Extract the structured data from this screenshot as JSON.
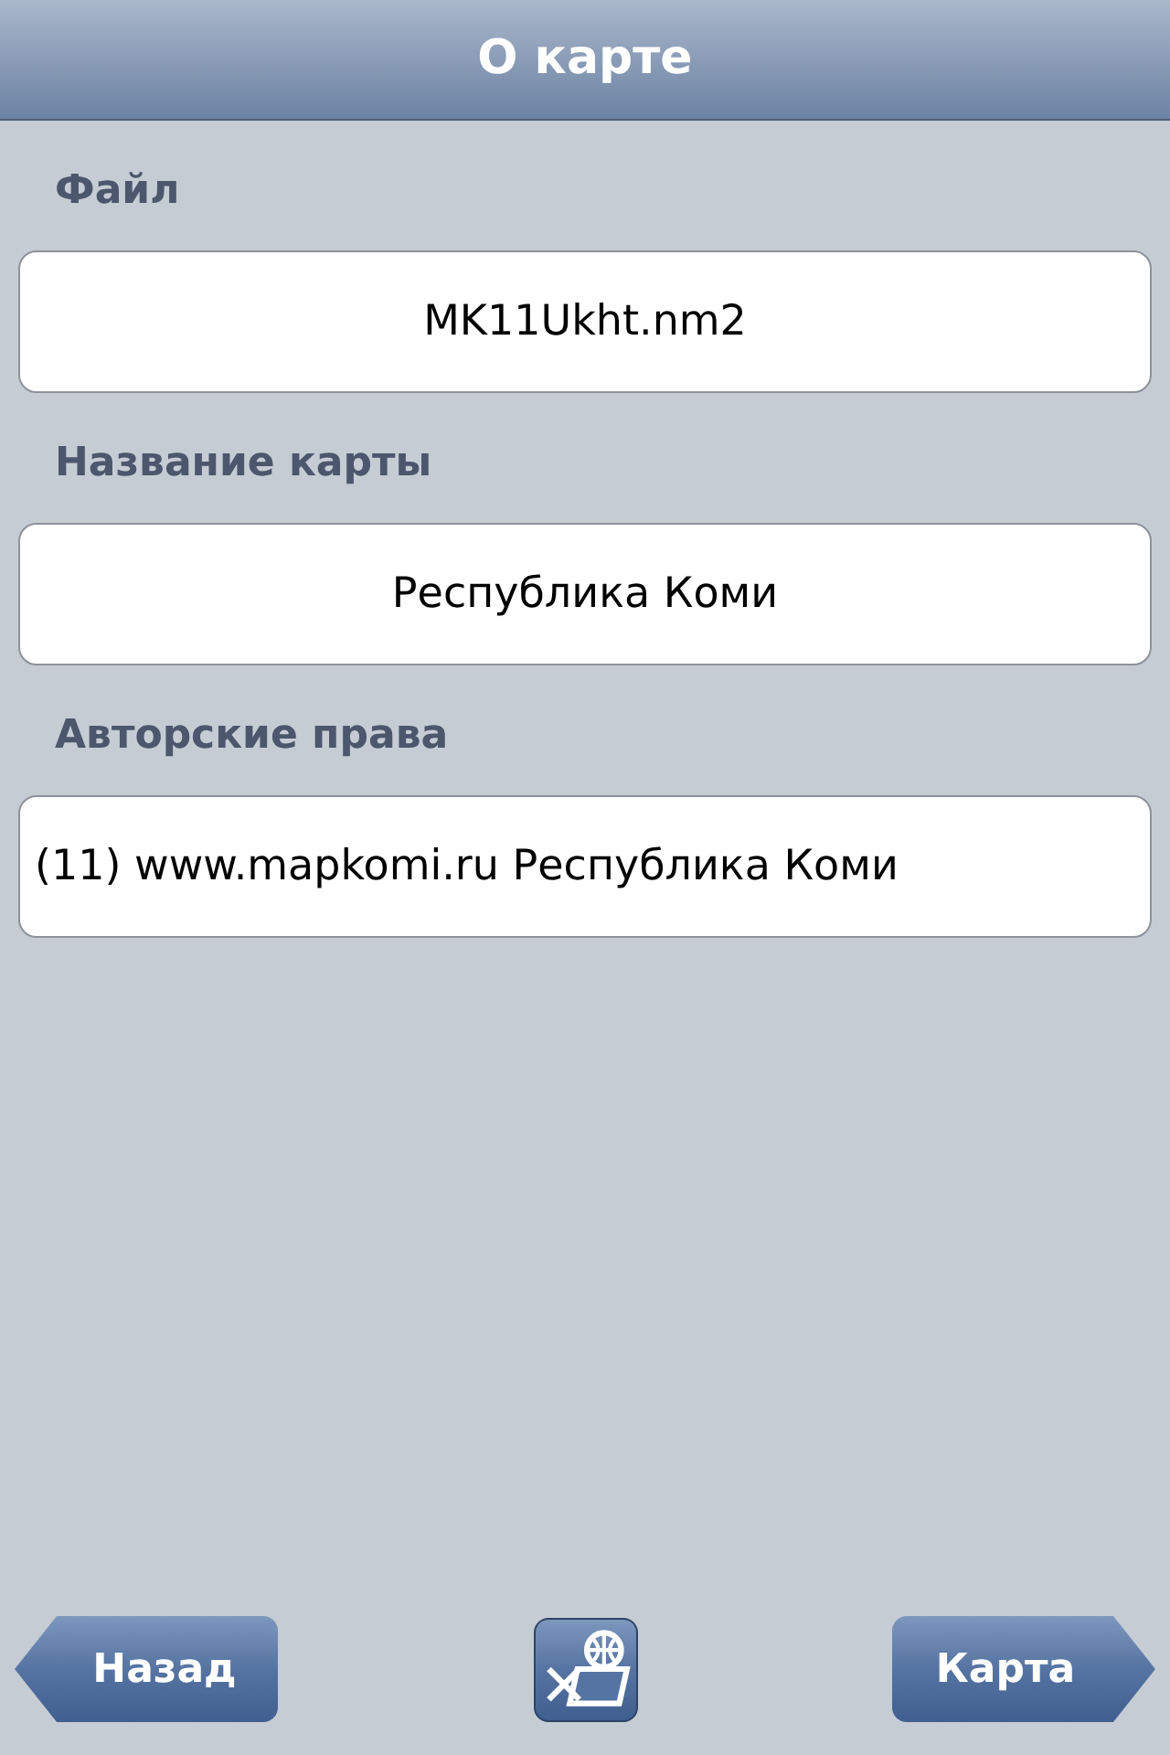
{
  "header": {
    "title": "О карте"
  },
  "fields": [
    {
      "label": "Файл",
      "value": "MK11Ukht.nm2",
      "kind": "centered"
    },
    {
      "label": "Название карты",
      "value": "Республика Коми",
      "kind": "centered"
    },
    {
      "label": "Авторские права",
      "value": "(11) www.mapkomi.ru Республика Коми",
      "kind": "plain"
    }
  ],
  "toolbar": {
    "back": "Назад",
    "forward": "Карта"
  }
}
